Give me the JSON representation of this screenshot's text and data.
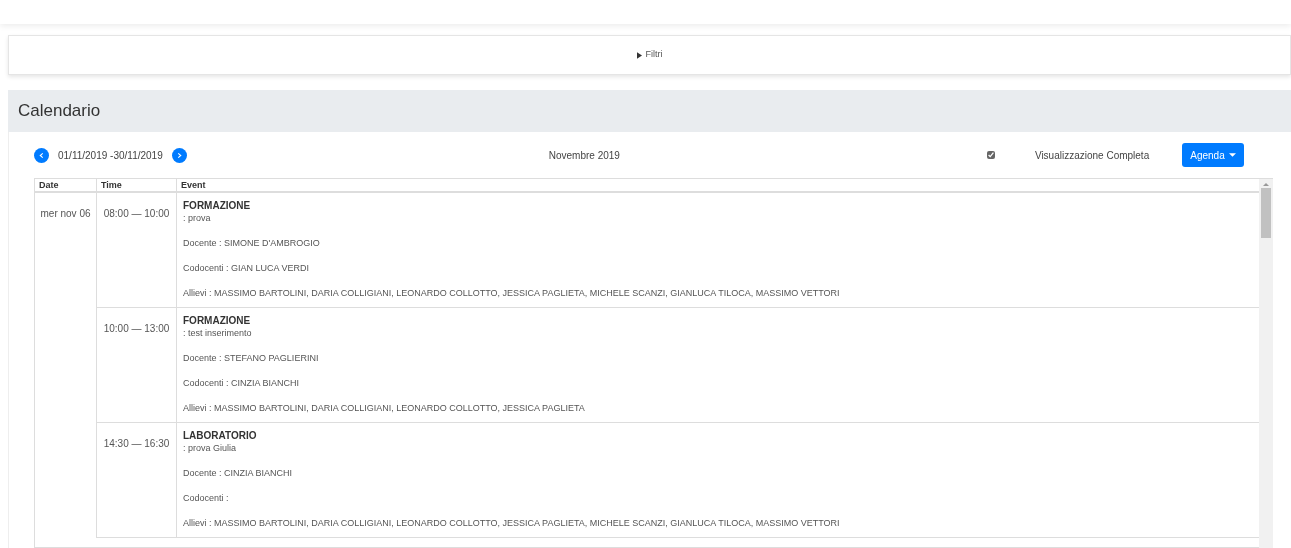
{
  "filters": {
    "label": "Filtri",
    "expanded": false
  },
  "calendar": {
    "title": "Calendario",
    "range": "01/11/2019 -30/11/2019",
    "month": "Novembre 2019",
    "full_view": {
      "label": "Visualizzazione Completa",
      "checked": true
    },
    "view_button": "Agenda",
    "columns": [
      "Date",
      "Time",
      "Event"
    ],
    "days": [
      {
        "date": "mer nov 06",
        "events": [
          {
            "time": "08:00 — 10:00",
            "title": "FORMAZIONE",
            "subtitle": ": prova",
            "details": [
              "Docente : SIMONE D'AMBROGIO",
              "Codocenti : GIAN LUCA VERDI",
              "Allievi : MASSIMO BARTOLINI, DARIA COLLIGIANI, LEONARDO COLLOTTO, JESSICA PAGLIETA, MICHELE SCANZI, GIANLUCA TILOCA, MASSIMO VETTORI"
            ]
          },
          {
            "time": "10:00 — 13:00",
            "title": "FORMAZIONE",
            "subtitle": ": test inserimento",
            "details": [
              "Docente : STEFANO PAGLIERINI",
              "Codocenti : CINZIA BIANCHI",
              "Allievi : MASSIMO BARTOLINI, DARIA COLLIGIANI, LEONARDO COLLOTTO, JESSICA PAGLIETA"
            ]
          },
          {
            "time": "14:30 — 16:30",
            "title": "LABORATORIO",
            "subtitle": ": prova Giulia",
            "details": [
              "Docente : CINZIA BIANCHI",
              "Codocenti :",
              "Allievi : MASSIMO BARTOLINI, DARIA COLLIGIANI, LEONARDO COLLOTTO, JESSICA PAGLIETA, MICHELE SCANZI, GIANLUCA TILOCA, MASSIMO VETTORI"
            ]
          }
        ]
      }
    ]
  }
}
